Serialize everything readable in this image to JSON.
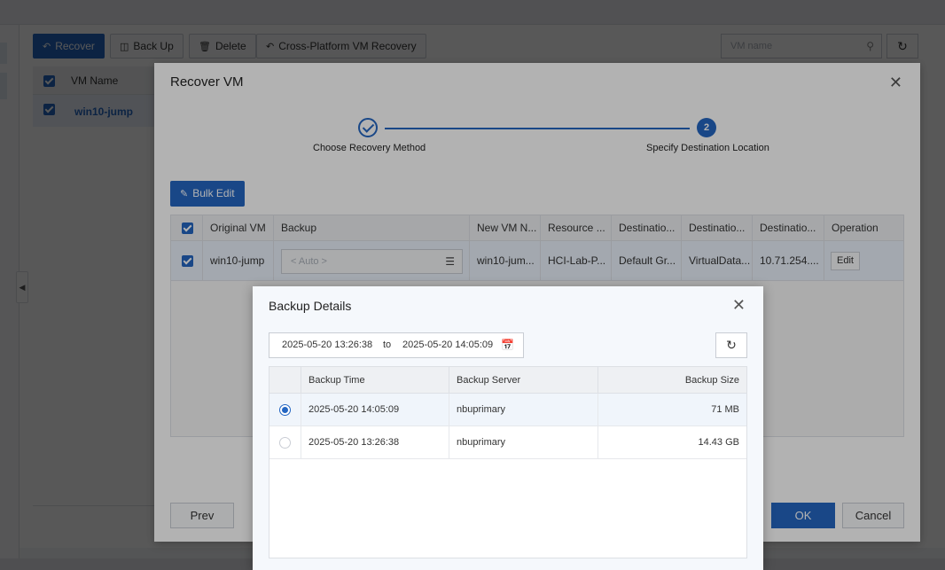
{
  "toolbar": {
    "recover_label": "Recover",
    "backup_label": "Back Up",
    "delete_label": "Delete",
    "cross_platform_label": "Cross-Platform VM Recovery",
    "search_placeholder": "VM name"
  },
  "vm_table": {
    "header": "VM Name",
    "rows": [
      "win10-jump"
    ]
  },
  "recover_dialog": {
    "title": "Recover VM",
    "steps": [
      {
        "number": "",
        "label": "Choose Recovery Method",
        "state": "done"
      },
      {
        "number": "2",
        "label": "Specify Destination Location",
        "state": "active"
      }
    ],
    "bulk_edit_label": "Bulk Edit",
    "columns": [
      "Original VM",
      "Backup",
      "New VM N...",
      "Resource ...",
      "Destinatio...",
      "Destinatio...",
      "Destinatio...",
      "Operation"
    ],
    "rows": [
      {
        "original_vm": "win10-jump",
        "backup": "< Auto >",
        "new_vm_name": "win10-jum...",
        "resource": "HCI-Lab-P...",
        "destination1": "Default Gr...",
        "destination2": "VirtualData...",
        "destination3": "10.71.254....",
        "operation": "Edit"
      }
    ],
    "prev_label": "Prev",
    "ok_label": "OK",
    "cancel_label": "Cancel"
  },
  "backup_details": {
    "title": "Backup Details",
    "date_from": "2025-05-20 13:26:38",
    "date_to_word": "to",
    "date_to": "2025-05-20 14:05:09",
    "columns": [
      "Backup Time",
      "Backup Server",
      "Backup Size"
    ],
    "rows": [
      {
        "time": "2025-05-20 14:05:09",
        "server": "nbuprimary",
        "size": "71 MB",
        "selected": true
      },
      {
        "time": "2025-05-20 13:26:38",
        "server": "nbuprimary",
        "size": "14.43 GB",
        "selected": false
      }
    ]
  },
  "colors": {
    "primary": "#2466c2",
    "row_selected": "#eaf1fb"
  }
}
